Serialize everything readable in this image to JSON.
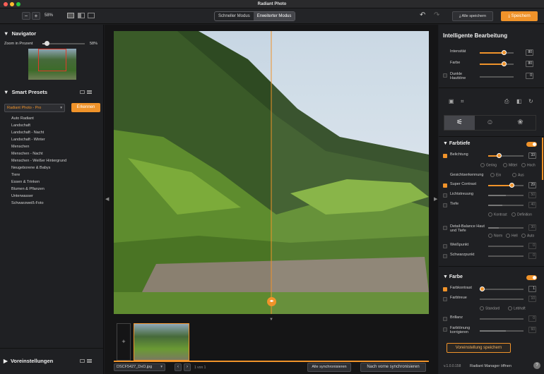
{
  "app": {
    "title": "Radiant Photo"
  },
  "toolbar": {
    "zoom_value": "58%",
    "modes": [
      "Schneller Modus",
      "Erweiterter Modus"
    ],
    "save_all": "Alle speichern",
    "save": "Speichern"
  },
  "navigator": {
    "title": "Navigator",
    "zoom_label": "Zoom in Prozent",
    "zoom_value": "58%"
  },
  "smart_presets": {
    "title": "Smart Presets",
    "selected": "Radiant Photo - Pro",
    "detect_button": "Erkennen",
    "items": [
      "Auto Radiant",
      "Landschaft",
      "Landschaft - Nacht",
      "Landschaft - Winter",
      "Menschen",
      "Menschen - Nacht",
      "Menschen - Weißer Hintergrund",
      "Neugeborene & Babys",
      "Tiere",
      "Essen & Trinken",
      "Blumen & Pflanzen",
      "Unterwasser",
      "Schwarzweiß-Foto"
    ]
  },
  "voreinstellungen": {
    "title": "Voreinstellungen"
  },
  "filmstrip": {
    "filename": "DSCF5427_DxO.jpg",
    "counter": "1 von 1",
    "sync_all": "Alle synchronisieren",
    "sync_forward": "Nach vorne synchronisieren"
  },
  "intelligent": {
    "title": "Intelligente Bearbeitung",
    "rows": [
      {
        "label": "Intensität",
        "value": "80",
        "pct": 0.72
      },
      {
        "label": "Farbe",
        "value": "80",
        "pct": 0.72
      },
      {
        "label": "Dunkle Hauttöne",
        "value": "0",
        "pct": 0
      }
    ]
  },
  "farbtiefe": {
    "title": "Farbtiefe",
    "belichtung": {
      "label": "Belichtung",
      "value": "33",
      "pct": 0.4
    },
    "belichtung_opts": [
      "Gering",
      "Mittel",
      "Hoch"
    ],
    "gesicht": {
      "label": "Gesichtserkennung",
      "opts": [
        "Ein",
        "Aus"
      ]
    },
    "rows": [
      {
        "label": "Super Contrast",
        "value": "29",
        "pct": 0.72,
        "on": true
      },
      {
        "label": "Lichtstreuung",
        "value": "50",
        "pct": 0.5,
        "on": false
      },
      {
        "label": "Tiefe",
        "value": "40",
        "pct": 0.4,
        "on": false
      }
    ],
    "tiefe_opts": [
      "Kontrast",
      "Definition"
    ],
    "detail": {
      "label": "Detail-Balance Haut und Tiefe",
      "value": "30",
      "pct": 0.3
    },
    "detail_opts": [
      "Norm",
      "Hell",
      "Auto"
    ],
    "rows2": [
      {
        "label": "Weißpunkt",
        "value": "0",
        "pct": 0.5
      },
      {
        "label": "Schwarzpunkt",
        "value": "0",
        "pct": 0.5
      }
    ]
  },
  "farbe": {
    "title": "Farbe",
    "rows": [
      {
        "label": "Farbkontrast",
        "value": "1",
        "pct": 0.05,
        "on": true
      },
      {
        "label": "Farbtreue",
        "value": "10",
        "pct": 0.5,
        "on": false
      }
    ],
    "opts": [
      "Standard",
      "Lebhaft"
    ],
    "rows2": [
      {
        "label": "Brillanz",
        "value": "0",
        "pct": 0.5
      },
      {
        "label": "Farbtönung korrigieren",
        "value": "60",
        "pct": 0.6
      }
    ]
  },
  "footer": {
    "save_preset": "Voreinstellung speichern",
    "version": "v.1.0.0.158",
    "manager": "Radiant Manager öffnen",
    "help": "?"
  }
}
